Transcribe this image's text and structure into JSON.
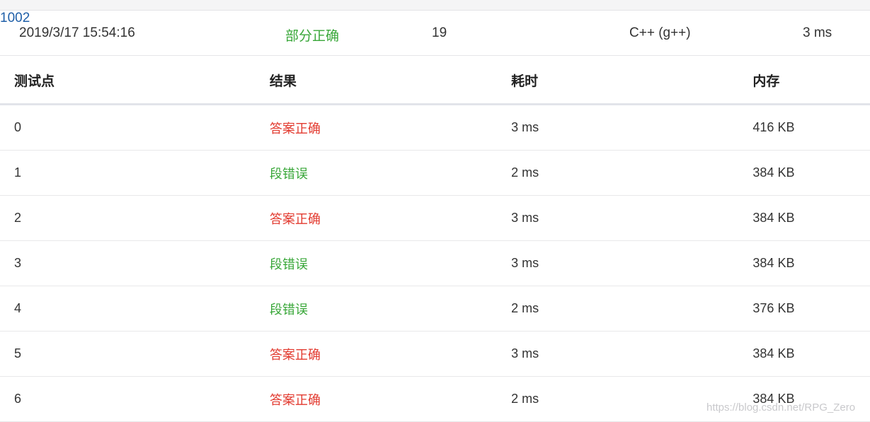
{
  "colors": {
    "accepted": "#e23a2f",
    "error": "#39a739",
    "partial": "#39a739",
    "link": "#1f5fa8"
  },
  "submission": {
    "time": "2019/3/17 15:54:16",
    "status": "部分正确",
    "score": "19",
    "problem": "1002",
    "language": "C++ (g++)",
    "duration": "3 ms"
  },
  "table": {
    "headers": [
      "测试点",
      "结果",
      "耗时",
      "内存"
    ],
    "rows": [
      {
        "case": "0",
        "result": "答案正确",
        "time": "3 ms",
        "memory": "416 KB",
        "status": "accepted"
      },
      {
        "case": "1",
        "result": "段错误",
        "time": "2 ms",
        "memory": "384 KB",
        "status": "error"
      },
      {
        "case": "2",
        "result": "答案正确",
        "time": "3 ms",
        "memory": "384 KB",
        "status": "accepted"
      },
      {
        "case": "3",
        "result": "段错误",
        "time": "3 ms",
        "memory": "384 KB",
        "status": "error"
      },
      {
        "case": "4",
        "result": "段错误",
        "time": "2 ms",
        "memory": "376 KB",
        "status": "error"
      },
      {
        "case": "5",
        "result": "答案正确",
        "time": "3 ms",
        "memory": "384 KB",
        "status": "accepted"
      },
      {
        "case": "6",
        "result": "答案正确",
        "time": "2 ms",
        "memory": "384 KB",
        "status": "accepted"
      }
    ]
  },
  "watermark": "https://blog.csdn.net/RPG_Zero"
}
